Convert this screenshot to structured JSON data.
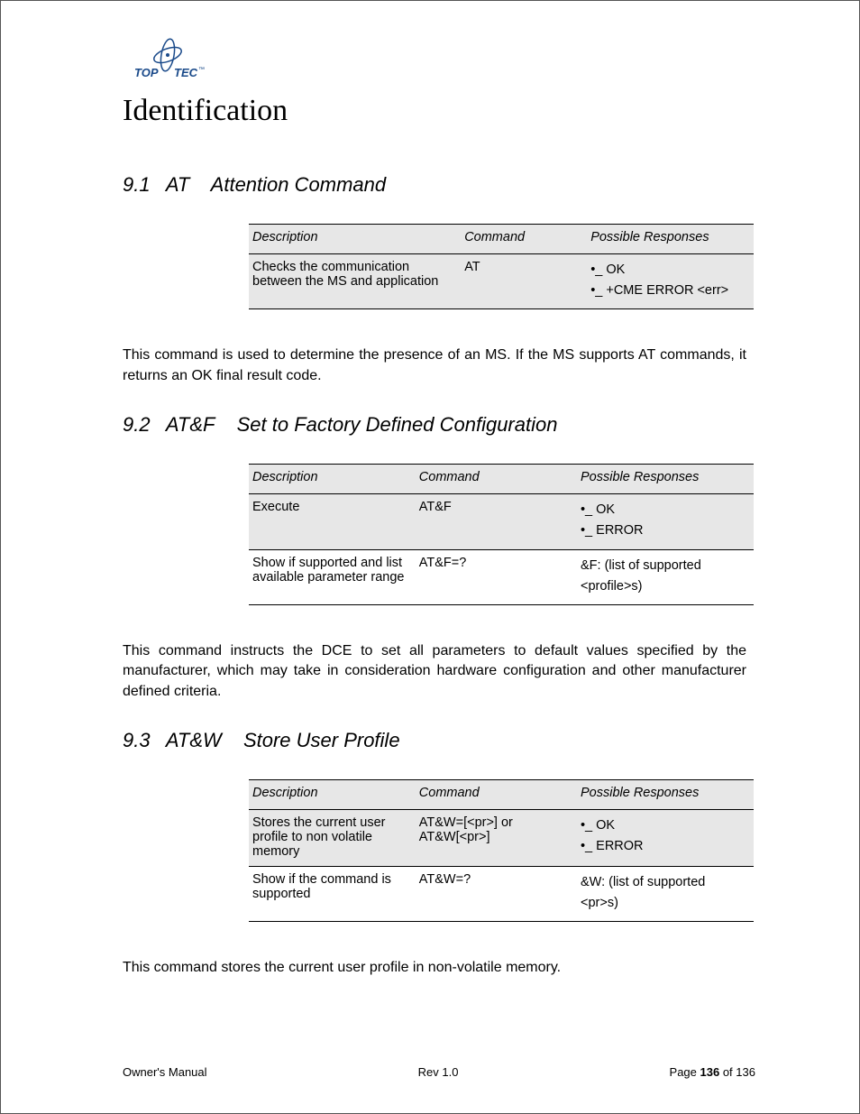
{
  "logo": {
    "left": "TOP",
    "right": "TEC"
  },
  "title": "Identification",
  "sections": [
    {
      "num": "9.1",
      "cmd": "AT",
      "name": "Attention Command",
      "table": {
        "headers": [
          "Description",
          "Command",
          "Possible Responses"
        ],
        "rows": [
          {
            "shaded": true,
            "desc": "Checks the communication between the MS and application",
            "cmd": "AT",
            "resp": [
              "•_ OK",
              "•_ +CME ERROR <err>"
            ]
          }
        ]
      },
      "body": "This command is used to determine the presence of an MS. If the MS supports AT commands, it returns an OK final result code.",
      "justify": true
    },
    {
      "num": "9.2",
      "cmd": "AT&F",
      "name": "Set to Factory Defined Configuration",
      "table": {
        "headers": [
          "Description",
          "Command",
          "Possible Responses"
        ],
        "rows": [
          {
            "shaded": true,
            "desc": "Execute",
            "cmd": "AT&F",
            "resp": [
              "•_ OK",
              "•_ ERROR"
            ]
          },
          {
            "shaded": false,
            "desc": "Show if supported and list available parameter range",
            "cmd": "AT&F=?",
            "resp": [
              "&F: (list of supported <profile>s)"
            ]
          }
        ]
      },
      "body": "This command instructs the DCE to set all parameters to default values specified by the manufacturer, which may take in consideration hardware configuration and other manufacturer defined criteria.",
      "justify": true
    },
    {
      "num": "9.3",
      "cmd": "AT&W",
      "name": "Store User Profile",
      "table": {
        "headers": [
          "Description",
          "Command",
          "Possible Responses"
        ],
        "rows": [
          {
            "shaded": true,
            "desc": "Stores the current user profile to non volatile memory",
            "cmd": "AT&W=[<pr>] or AT&W[<pr>]",
            "resp": [
              "•_ OK",
              "•_ ERROR"
            ]
          },
          {
            "shaded": false,
            "desc": "Show if the command is supported",
            "cmd": "AT&W=?",
            "resp": [
              "&W: (list of supported <pr>s)"
            ]
          }
        ]
      },
      "body": "This command stores the current user profile in non-volatile memory.",
      "justify": false
    }
  ],
  "footer": {
    "left": "Owner's Manual",
    "center": "Rev 1.0",
    "right_prefix": "Page ",
    "right_page": "136",
    "right_of": " of 136"
  }
}
